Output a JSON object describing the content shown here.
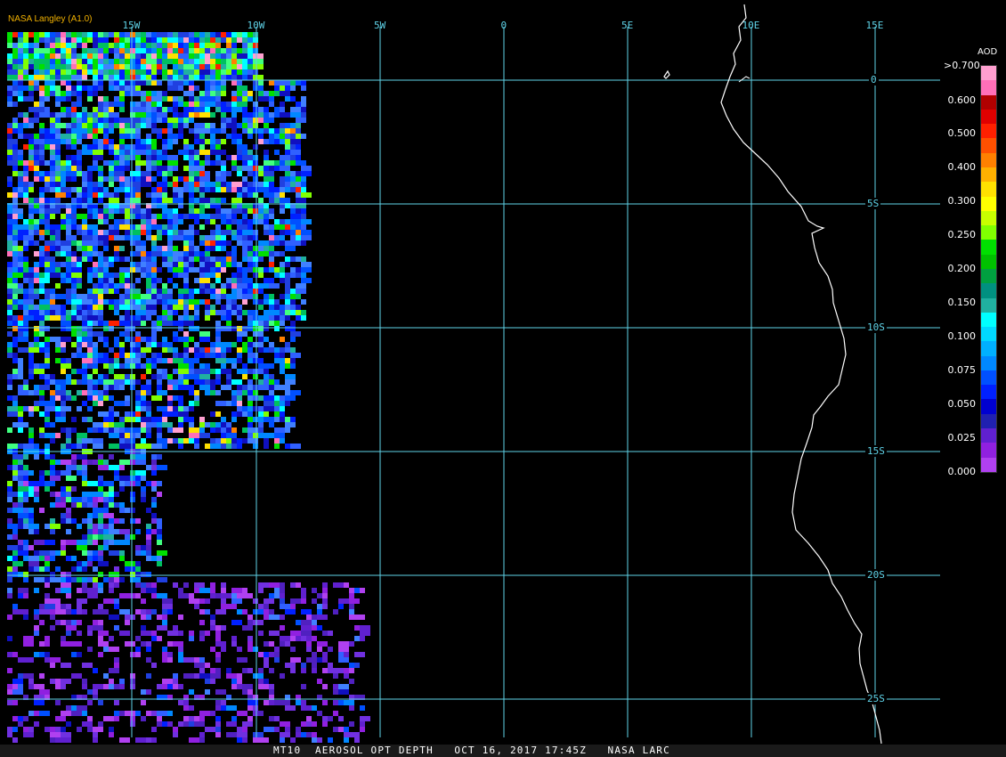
{
  "header": {
    "producer": "NASA Langley (A1.0)"
  },
  "map": {
    "lon_labels": [
      "15W",
      "10W",
      "5W",
      "0",
      "5E",
      "10E",
      "15E"
    ],
    "lat_labels": [
      "0",
      "5S",
      "10S",
      "15S",
      "20S",
      "25S"
    ],
    "grid_color": "#5fd3e8",
    "coastline_color": "#ffffff"
  },
  "legend": {
    "title": "AOD",
    "labels": [
      ">0.700",
      "0.600",
      "0.500",
      "0.400",
      "0.300",
      "0.250",
      "0.200",
      "0.150",
      "0.100",
      "0.075",
      "0.050",
      "0.025",
      "0.000"
    ],
    "colors": [
      "#ff9fd0",
      "#ff6fb8",
      "#b00000",
      "#e00000",
      "#ff2000",
      "#ff5000",
      "#ff8000",
      "#ffb000",
      "#ffe000",
      "#ffff00",
      "#c8ff00",
      "#80ff00",
      "#00e000",
      "#00c000",
      "#00a040",
      "#009080",
      "#20b0a0",
      "#00ffff",
      "#00d8ff",
      "#00b0ff",
      "#0088ff",
      "#0050ff",
      "#0020ff",
      "#0000d0",
      "#2020b0",
      "#6020d0",
      "#9020e0",
      "#b040f0"
    ]
  },
  "footer": {
    "product": "MT10",
    "title": "AEROSOL OPT DEPTH",
    "date": "OCT 16, 2017 17:45Z",
    "source": "NASA LARC"
  }
}
